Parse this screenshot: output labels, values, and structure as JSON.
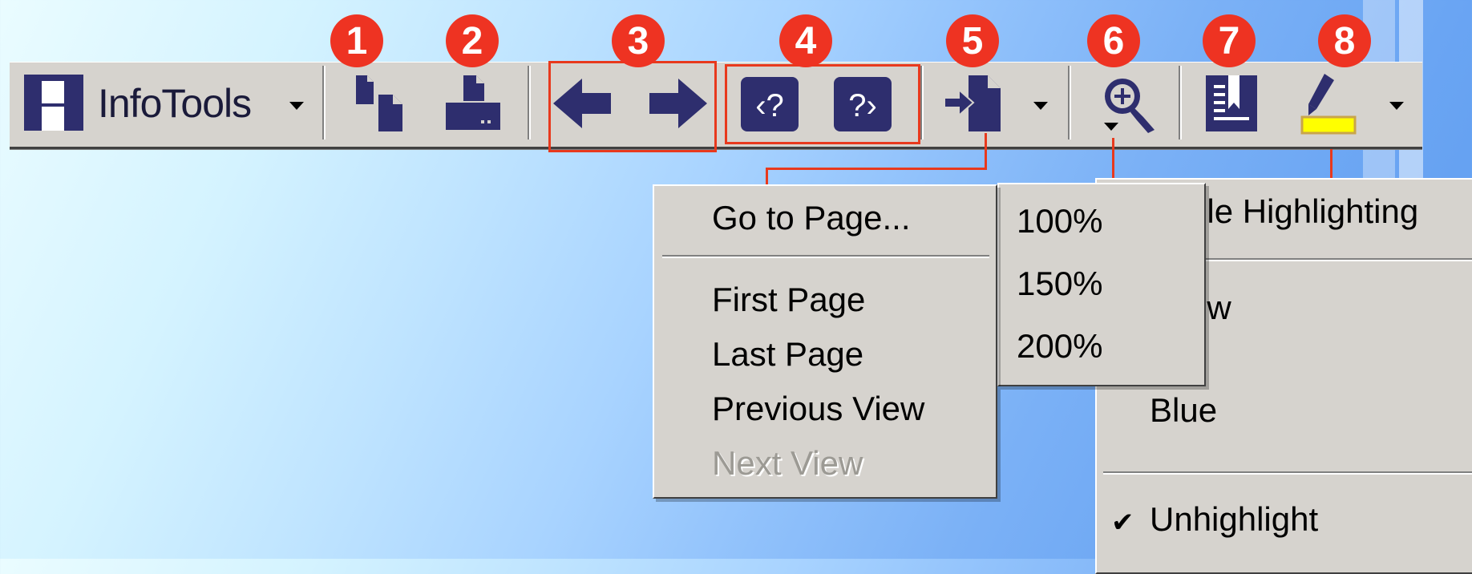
{
  "app": {
    "name": "InfoTools"
  },
  "badges": [
    "1",
    "2",
    "3",
    "4",
    "5",
    "6",
    "7",
    "8"
  ],
  "goto_menu": {
    "goto_label": "Go to Page...",
    "items": [
      "First Page",
      "Last Page",
      "Previous View"
    ],
    "disabled_item": "Next View"
  },
  "zoom_menu": {
    "options": [
      "100%",
      "150%",
      "200%"
    ]
  },
  "highlight_menu": {
    "toggle_label_partial": "gle Highlighting",
    "partial_item": "ow",
    "partial_item2": ".",
    "blue_label": "Blue",
    "check_mark": "✔",
    "unhighlight_label": "Unhighlight"
  },
  "colors": {
    "toolbar_bg": "#d6d3ce",
    "icon_navy": "#2e2e6e",
    "callout_red": "#e8391d",
    "highlight_yellow": "#ffff00"
  },
  "icons": [
    "infotools-logo-icon",
    "copy-pages-icon",
    "print-icon",
    "back-arrow-icon",
    "forward-arrow-icon",
    "previous-search-hit-icon",
    "next-search-hit-icon",
    "go-to-page-icon",
    "zoom-icon",
    "bookmark-icon",
    "highlighter-icon"
  ]
}
